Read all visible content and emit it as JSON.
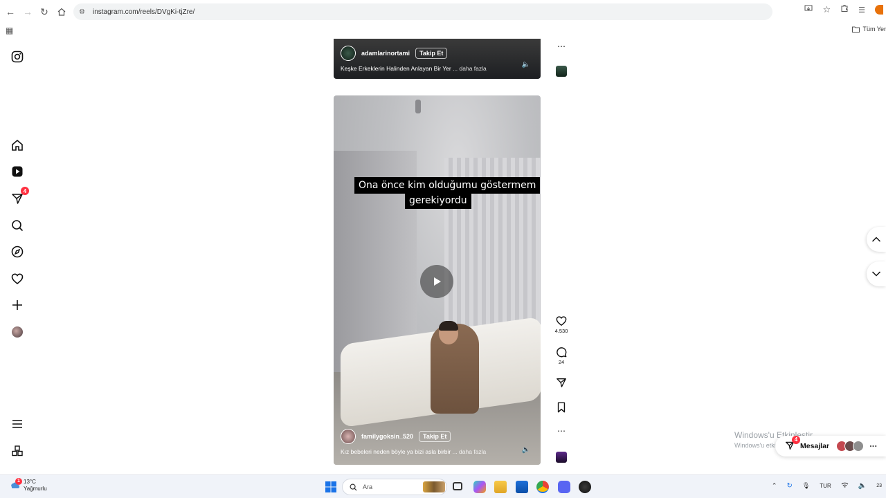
{
  "browser": {
    "url": "instagram.com/reels/DVgKi-tjZre/",
    "bookmarks_all": "Tüm Yer"
  },
  "left_nav": {
    "notifications_badge": "4"
  },
  "reels": [
    {
      "username": "adamlarinortami",
      "follow_label": "Takip Et",
      "description": "Keşke Erkeklerin Halinden Anlayan Bir Yer",
      "more_label": "... daha fazla"
    },
    {
      "caption_line1": "Ona önce kim olduğumu göstermem",
      "caption_line2": "gerekiyordu",
      "username": "familygoksin_520",
      "follow_label": "Takip Et",
      "description": "Kız bebeleri neden böyle ya bizi asla birbir",
      "more_label": "... daha fazla",
      "likes": "4.530",
      "comments": "24"
    }
  ],
  "windows": {
    "activate_title": "Windows'u Etkinleştir",
    "activate_sub": "Windows'u etkinleştirmek için Ayarlar'a gidin."
  },
  "messages": {
    "label": "Mesajlar",
    "badge": "4"
  },
  "taskbar": {
    "temperature": "13°C",
    "weather": "Yağmurlu",
    "weather_badge": "1",
    "search_placeholder": "Ara",
    "language": "TUR",
    "clock": "23"
  },
  "colors": {
    "badge_red": "#ff3040",
    "accent_blue": "#0a84ff"
  }
}
